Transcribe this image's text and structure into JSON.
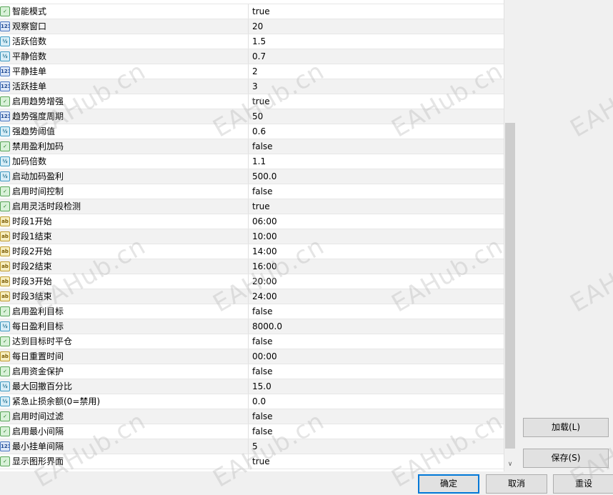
{
  "params": [
    {
      "type": "bool",
      "icon": "✓",
      "name": "智能模式",
      "value": "true"
    },
    {
      "type": "int",
      "icon": "123",
      "name": "观察窗口",
      "value": "20"
    },
    {
      "type": "dbl",
      "icon": "½",
      "name": "活跃倍数",
      "value": "1.5"
    },
    {
      "type": "dbl",
      "icon": "½",
      "name": "平静倍数",
      "value": "0.7"
    },
    {
      "type": "int",
      "icon": "123",
      "name": "平静挂单",
      "value": "2"
    },
    {
      "type": "int",
      "icon": "123",
      "name": "活跃挂单",
      "value": "3"
    },
    {
      "type": "bool",
      "icon": "✓",
      "name": "启用趋势增强",
      "value": "true"
    },
    {
      "type": "int",
      "icon": "123",
      "name": "趋势强度周期",
      "value": "50"
    },
    {
      "type": "dbl",
      "icon": "½",
      "name": "强趋势阈值",
      "value": "0.6"
    },
    {
      "type": "bool",
      "icon": "✓",
      "name": "禁用盈利加码",
      "value": "false"
    },
    {
      "type": "dbl",
      "icon": "½",
      "name": "加码倍数",
      "value": "1.1"
    },
    {
      "type": "dbl",
      "icon": "½",
      "name": "启动加码盈利",
      "value": "500.0"
    },
    {
      "type": "bool",
      "icon": "✓",
      "name": "启用时间控制",
      "value": "false"
    },
    {
      "type": "bool",
      "icon": "✓",
      "name": "启用灵活时段检测",
      "value": "true"
    },
    {
      "type": "str",
      "icon": "ab",
      "name": "时段1开始",
      "value": "06:00"
    },
    {
      "type": "str",
      "icon": "ab",
      "name": "时段1结束",
      "value": "10:00"
    },
    {
      "type": "str",
      "icon": "ab",
      "name": "时段2开始",
      "value": "14:00"
    },
    {
      "type": "str",
      "icon": "ab",
      "name": "时段2结束",
      "value": "16:00"
    },
    {
      "type": "str",
      "icon": "ab",
      "name": "时段3开始",
      "value": "20:00"
    },
    {
      "type": "str",
      "icon": "ab",
      "name": "时段3结束",
      "value": "24:00"
    },
    {
      "type": "bool",
      "icon": "✓",
      "name": "启用盈利目标",
      "value": "false"
    },
    {
      "type": "dbl",
      "icon": "½",
      "name": "每日盈利目标",
      "value": "8000.0"
    },
    {
      "type": "bool",
      "icon": "✓",
      "name": "达到目标时平仓",
      "value": "false"
    },
    {
      "type": "str",
      "icon": "ab",
      "name": "每日重置时间",
      "value": "00:00"
    },
    {
      "type": "bool",
      "icon": "✓",
      "name": "启用资金保护",
      "value": "false"
    },
    {
      "type": "dbl",
      "icon": "½",
      "name": "最大回撤百分比",
      "value": "15.0"
    },
    {
      "type": "dbl",
      "icon": "½",
      "name": "紧急止损余额(0=禁用)",
      "value": "0.0"
    },
    {
      "type": "bool",
      "icon": "✓",
      "name": "启用时间过滤",
      "value": "false"
    },
    {
      "type": "bool",
      "icon": "✓",
      "name": "启用最小间隔",
      "value": "false"
    },
    {
      "type": "int",
      "icon": "123",
      "name": "最小挂单间隔",
      "value": "5"
    },
    {
      "type": "bool",
      "icon": "✓",
      "name": "显示图形界面",
      "value": "true"
    }
  ],
  "side_buttons": {
    "load": "加载(L)",
    "save": "保存(S)"
  },
  "buttons": {
    "ok": "确定",
    "cancel": "取消",
    "reset": "重设"
  },
  "watermark": "EAHub.cn"
}
